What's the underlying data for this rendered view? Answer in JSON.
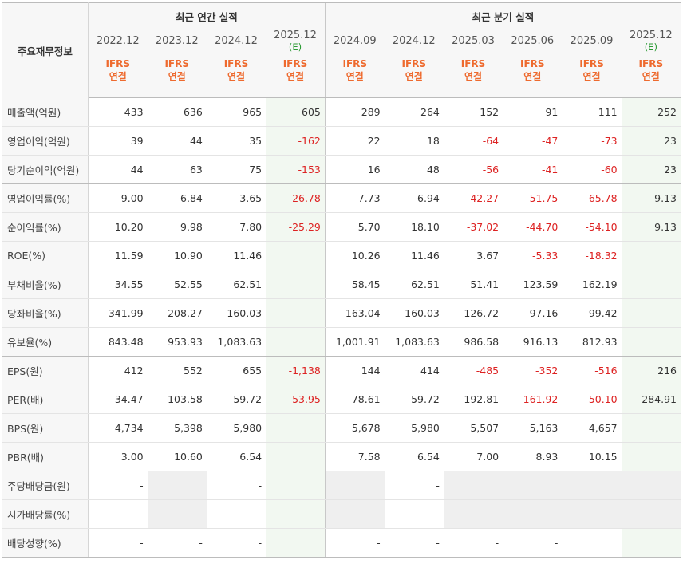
{
  "header": {
    "row_label": "주요재무정보",
    "annual_title": "최근 연간 실적",
    "quarter_title": "최근 분기 실적",
    "periods": [
      "2022.12",
      "2023.12",
      "2024.12",
      "2025.12",
      "2024.09",
      "2024.12",
      "2025.03",
      "2025.06",
      "2025.09",
      "2025.12"
    ],
    "estimate_mark": "(E)",
    "basis_top": "IFRS",
    "basis_bottom": "연결"
  },
  "rows": [
    {
      "label": "매출액(억원)",
      "values": [
        "433",
        "636",
        "965",
        "605",
        "289",
        "264",
        "152",
        "91",
        "111",
        "252"
      ]
    },
    {
      "label": "영업이익(억원)",
      "values": [
        "39",
        "44",
        "35",
        "-162",
        "22",
        "18",
        "-64",
        "-47",
        "-73",
        "23"
      ]
    },
    {
      "label": "당기순이익(억원)",
      "values": [
        "44",
        "63",
        "75",
        "-153",
        "16",
        "48",
        "-56",
        "-41",
        "-60",
        "23"
      ]
    },
    {
      "label": "영업이익률(%)",
      "values": [
        "9.00",
        "6.84",
        "3.65",
        "-26.78",
        "7.73",
        "6.94",
        "-42.27",
        "-51.75",
        "-65.78",
        "9.13"
      ]
    },
    {
      "label": "순이익률(%)",
      "values": [
        "10.20",
        "9.98",
        "7.80",
        "-25.29",
        "5.70",
        "18.10",
        "-37.02",
        "-44.70",
        "-54.10",
        "9.13"
      ]
    },
    {
      "label": "ROE(%)",
      "values": [
        "11.59",
        "10.90",
        "11.46",
        "",
        "10.26",
        "11.46",
        "3.67",
        "-5.33",
        "-18.32",
        ""
      ]
    },
    {
      "label": "부채비율(%)",
      "values": [
        "34.55",
        "52.55",
        "62.51",
        "",
        "58.45",
        "62.51",
        "51.41",
        "123.59",
        "162.19",
        ""
      ]
    },
    {
      "label": "당좌비율(%)",
      "values": [
        "341.99",
        "208.27",
        "160.03",
        "",
        "163.04",
        "160.03",
        "126.72",
        "97.16",
        "99.42",
        ""
      ]
    },
    {
      "label": "유보율(%)",
      "values": [
        "843.48",
        "953.93",
        "1,083.63",
        "",
        "1,001.91",
        "1,083.63",
        "986.58",
        "916.13",
        "812.93",
        ""
      ]
    },
    {
      "label": "EPS(원)",
      "values": [
        "412",
        "552",
        "655",
        "-1,138",
        "144",
        "414",
        "-485",
        "-352",
        "-516",
        "216"
      ]
    },
    {
      "label": "PER(배)",
      "values": [
        "34.47",
        "103.58",
        "59.72",
        "-53.95",
        "78.61",
        "59.72",
        "192.81",
        "-161.92",
        "-50.10",
        "284.91"
      ]
    },
    {
      "label": "BPS(원)",
      "values": [
        "4,734",
        "5,398",
        "5,980",
        "",
        "5,678",
        "5,980",
        "5,507",
        "5,163",
        "4,657",
        ""
      ]
    },
    {
      "label": "PBR(배)",
      "values": [
        "3.00",
        "10.60",
        "6.54",
        "",
        "7.58",
        "6.54",
        "7.00",
        "8.93",
        "10.15",
        ""
      ]
    },
    {
      "label": "주당배당금(원)",
      "values": [
        "-",
        "",
        "-",
        "",
        "",
        "-",
        "",
        "",
        "",
        ""
      ]
    },
    {
      "label": "시가배당률(%)",
      "values": [
        "-",
        "",
        "-",
        "",
        "",
        "-",
        "",
        "",
        "",
        ""
      ]
    },
    {
      "label": "배당성향(%)",
      "values": [
        "-",
        "-",
        "-",
        "",
        "-",
        "-",
        "-",
        "-",
        "",
        ""
      ]
    }
  ],
  "colors": {
    "negative": "#dd2222",
    "basis_accent": "#ee6a2e",
    "estimate_accent": "#2c9b35",
    "estimate_column_bg": "#f2f8f1",
    "empty_cell_bg": "#efefef"
  }
}
